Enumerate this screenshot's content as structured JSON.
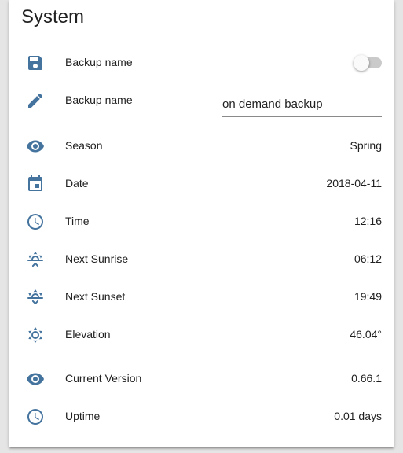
{
  "card": {
    "title": "System"
  },
  "rows": [
    {
      "icon": "floppy-disk-icon",
      "label": "Backup name",
      "control": "toggle",
      "toggle_state": "off"
    },
    {
      "icon": "pencil-icon",
      "label": "Backup name",
      "control": "text-input",
      "input_value": "on demand backup"
    },
    {
      "icon": "eye-icon",
      "label": "Season",
      "value": "Spring"
    },
    {
      "icon": "calendar-icon",
      "label": "Date",
      "value": "2018-04-11"
    },
    {
      "icon": "clock-icon",
      "label": "Time",
      "value": "12:16"
    },
    {
      "icon": "sunrise-icon",
      "label": "Next Sunrise",
      "value": "06:12"
    },
    {
      "icon": "sunset-icon",
      "label": "Next Sunset",
      "value": "19:49"
    },
    {
      "icon": "sun-icon",
      "label": "Elevation",
      "value": "46.04°"
    },
    {
      "icon": "eye-icon",
      "label": "Current Version",
      "value": "0.66.1"
    },
    {
      "icon": "clock-icon",
      "label": "Uptime",
      "value": "0.01 days"
    }
  ],
  "colors": {
    "icon": "#44739e",
    "text": "#212121",
    "background": "#e5e5e5",
    "card": "#ffffff"
  }
}
